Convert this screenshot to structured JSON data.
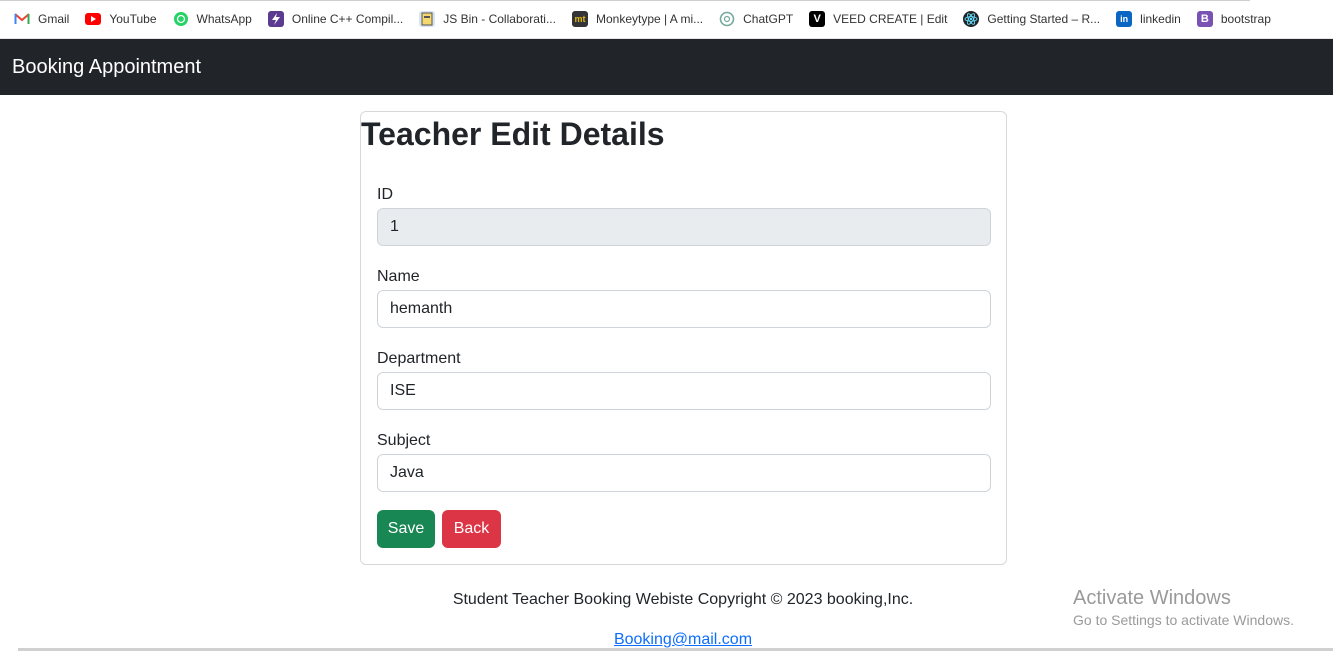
{
  "bookmarks": [
    {
      "label": "Gmail",
      "icon": "gmail-icon"
    },
    {
      "label": "YouTube",
      "icon": "youtube-icon"
    },
    {
      "label": "WhatsApp",
      "icon": "whatsapp-icon"
    },
    {
      "label": "Online C++ Compil...",
      "icon": "lightning-icon"
    },
    {
      "label": "JS Bin - Collaborati...",
      "icon": "jsbin-icon"
    },
    {
      "label": "Monkeytype | A mi...",
      "icon": "monkeytype-icon"
    },
    {
      "label": "ChatGPT",
      "icon": "chatgpt-icon"
    },
    {
      "label": "VEED CREATE | Edit",
      "icon": "veed-icon"
    },
    {
      "label": "Getting Started – R...",
      "icon": "react-icon"
    },
    {
      "label": "linkedin",
      "icon": "linkedin-icon"
    },
    {
      "label": "bootstrap",
      "icon": "bootstrap-icon"
    }
  ],
  "navbar": {
    "brand": "Booking Appointment"
  },
  "form": {
    "title": "Teacher Edit Details",
    "id_label": "ID",
    "id_value": "1",
    "name_label": "Name",
    "name_value": "hemanth",
    "department_label": "Department",
    "department_value": "ISE",
    "subject_label": "Subject",
    "subject_value": "Java",
    "save_label": "Save",
    "back_label": "Back"
  },
  "footer": {
    "text": "Student Teacher Booking Webiste Copyright © 2023 booking,Inc.",
    "email": "Booking@mail.com"
  },
  "watermark": {
    "title": "Activate Windows",
    "subtitle": "Go to Settings to activate Windows."
  },
  "colors": {
    "navbar": "#212529",
    "save": "#198754",
    "back": "#dc3545",
    "link": "#0d6efd"
  }
}
